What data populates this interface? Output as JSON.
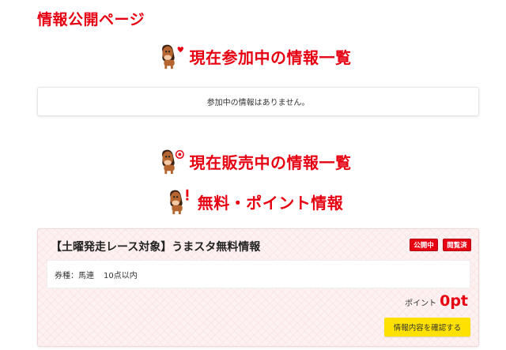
{
  "page": {
    "title": "情報公開ページ"
  },
  "sections": {
    "participating": {
      "heading": "現在参加中の情報一覧",
      "icon": "horse-heart-icon",
      "empty_message": "参加中の情報はありません。"
    },
    "on_sale": {
      "heading": "現在販売中の情報一覧",
      "icon": "horse-target-icon"
    },
    "free_point": {
      "heading": "無料・ポイント情報",
      "icon": "horse-exclamation-icon"
    }
  },
  "card": {
    "title": "【土曜発走レース対象】うまスタ無料情報",
    "badges": [
      "公開中",
      "閲覧済"
    ],
    "ticket_label": "券種：馬連",
    "ticket_detail": "10点以内",
    "points_label": "ポイント",
    "points_value": "0pt",
    "confirm_button": "情報内容を確認する"
  },
  "colors": {
    "accent": "#e60012",
    "button": "#ffe100",
    "card_bg": "#fdf1f1"
  }
}
